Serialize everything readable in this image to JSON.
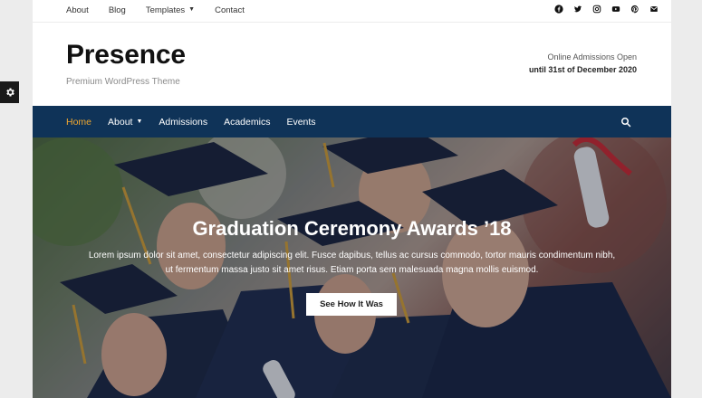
{
  "top_nav": {
    "items": [
      {
        "label": "About"
      },
      {
        "label": "Blog"
      },
      {
        "label": "Templates",
        "chevron": "chevron-down-icon"
      },
      {
        "label": "Contact"
      }
    ]
  },
  "social_icons": [
    "facebook-icon",
    "twitter-icon",
    "instagram-icon",
    "youtube-icon",
    "pinterest-icon",
    "mail-icon"
  ],
  "header": {
    "title": "Presence",
    "tagline": "Premium WordPress Theme",
    "admissions_line1": "Online Admissions Open",
    "admissions_line2": "until 31st of December 2020"
  },
  "main_nav": {
    "items": [
      {
        "label": "Home",
        "active": true
      },
      {
        "label": "About",
        "chevron": "chevron-down-icon"
      },
      {
        "label": "Admissions"
      },
      {
        "label": "Academics"
      },
      {
        "label": "Events"
      }
    ],
    "search_icon": "search-icon",
    "background": "#0f3358",
    "active_color": "#f0a830"
  },
  "hero": {
    "title": "Graduation Ceremony Awards ’18",
    "text": "Lorem ipsum dolor sit amet, consectetur adipiscing elit. Fusce dapibus, tellus ac cursus commodo, tortor mauris condimentum nibh, ut fermentum massa justo sit amet risus. Etiam porta sem malesuada magna mollis euismod.",
    "button_label": "See How It Was"
  },
  "side_panel": {
    "icon": "gear-icon"
  }
}
